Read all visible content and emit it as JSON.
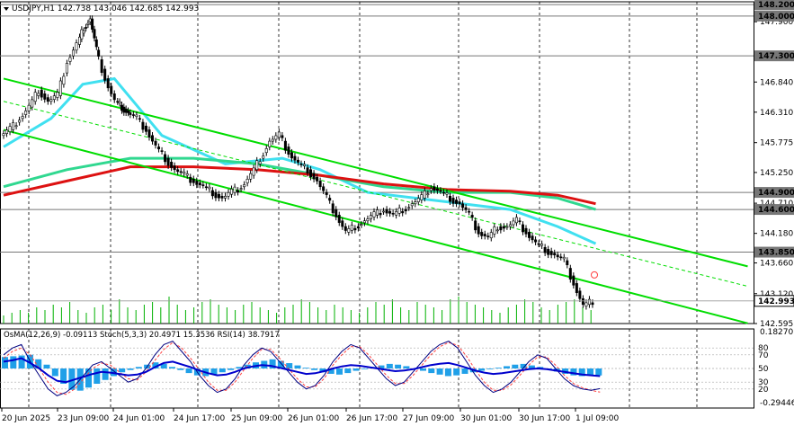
{
  "main": {
    "symbol_header": "USDJPY,H1  142.738 143.046 142.685 142.993",
    "price_ticks": [
      "148.200",
      "147.900",
      "147.300",
      "146.840",
      "146.310",
      "145.775",
      "145.250",
      "144.710",
      "144.180",
      "143.660",
      "143.120",
      "142.595"
    ],
    "levels": [
      {
        "price": "148.200",
        "role": "resistance"
      },
      {
        "price": "148.000",
        "role": "resistance"
      },
      {
        "price": "147.300",
        "role": "resistance"
      },
      {
        "price": "144.900",
        "role": "level"
      },
      {
        "price": "144.600",
        "role": "level"
      },
      {
        "price": "143.850",
        "role": "level"
      }
    ],
    "current_price": "142.993"
  },
  "indicator": {
    "header": "OsMA(12,26,9) -0.09113  Stoch(5,3,3) 20.4971 15.3536  RSI(14) 38.7917",
    "scale_right": [
      "0.182701",
      "-0.294465"
    ],
    "scale_left": [
      "80",
      "70",
      "50",
      "30",
      "20"
    ]
  },
  "time_axis": [
    "20 Jun 2025",
    "23 Jun 09:00",
    "24 Jun 01:00",
    "24 Jun 17:00",
    "25 Jun 09:00",
    "26 Jun 01:00",
    "26 Jun 17:00",
    "27 Jun 09:00",
    "30 Jun 01:00",
    "30 Jun 17:00",
    "1 Jul 09:00"
  ],
  "colors": {
    "channel": "#00dd00",
    "ema_short": "#40e0f0",
    "ema_mid": "#30d890",
    "ema_long": "#dd1111",
    "level_line": "#777777",
    "osma": "#20a0e8",
    "stoch_main": "#000080",
    "stoch_signal": "#ff4040",
    "rsi": "#0000cc",
    "volume": "#00b000"
  },
  "chart_data": {
    "type": "candlestick",
    "title": "USDJPY,H1",
    "ylim": [
      142.595,
      148.25
    ],
    "ohlc_header": {
      "open": 142.738,
      "high": 143.046,
      "low": 142.685,
      "close": 142.993
    },
    "candles_close_path": [
      [
        0,
        145.9
      ],
      [
        3,
        146.0
      ],
      [
        6,
        146.2
      ],
      [
        9,
        146.4
      ],
      [
        12,
        146.7
      ],
      [
        15,
        146.5
      ],
      [
        18,
        146.6
      ],
      [
        21,
        147.2
      ],
      [
        24,
        147.5
      ],
      [
        26,
        147.8
      ],
      [
        28,
        147.95
      ],
      [
        30,
        147.4
      ],
      [
        33,
        146.9
      ],
      [
        36,
        146.5
      ],
      [
        38,
        146.4
      ],
      [
        40,
        146.3
      ],
      [
        43,
        146.2
      ],
      [
        46,
        146.0
      ],
      [
        49,
        145.7
      ],
      [
        52,
        145.5
      ],
      [
        55,
        145.3
      ],
      [
        58,
        145.2
      ],
      [
        61,
        145.1
      ],
      [
        64,
        145.0
      ],
      [
        67,
        144.9
      ],
      [
        70,
        144.8
      ],
      [
        73,
        144.9
      ],
      [
        76,
        145.0
      ],
      [
        79,
        145.2
      ],
      [
        82,
        145.5
      ],
      [
        85,
        145.8
      ],
      [
        88,
        145.9
      ],
      [
        91,
        145.6
      ],
      [
        94,
        145.4
      ],
      [
        97,
        145.3
      ],
      [
        100,
        145.1
      ],
      [
        103,
        144.8
      ],
      [
        106,
        144.5
      ],
      [
        109,
        144.2
      ],
      [
        112,
        144.3
      ],
      [
        115,
        144.4
      ],
      [
        118,
        144.5
      ],
      [
        121,
        144.6
      ],
      [
        124,
        144.5
      ],
      [
        127,
        144.6
      ],
      [
        130,
        144.7
      ],
      [
        133,
        144.8
      ],
      [
        136,
        145.0
      ],
      [
        139,
        144.9
      ],
      [
        142,
        144.8
      ],
      [
        145,
        144.7
      ],
      [
        148,
        144.5
      ],
      [
        151,
        144.2
      ],
      [
        154,
        144.1
      ],
      [
        157,
        144.3
      ],
      [
        160,
        144.3
      ],
      [
        163,
        144.4
      ],
      [
        166,
        144.2
      ],
      [
        169,
        144.0
      ],
      [
        172,
        143.9
      ],
      [
        175,
        143.8
      ],
      [
        178,
        143.7
      ],
      [
        181,
        143.3
      ],
      [
        184,
        142.9
      ],
      [
        187,
        142.99
      ]
    ],
    "series": [
      {
        "name": "EMA short",
        "kind": "line",
        "values": [
          [
            0,
            145.7
          ],
          [
            15,
            146.2
          ],
          [
            25,
            146.8
          ],
          [
            35,
            146.9
          ],
          [
            50,
            145.9
          ],
          [
            70,
            145.4
          ],
          [
            88,
            145.5
          ],
          [
            100,
            145.3
          ],
          [
            115,
            144.9
          ],
          [
            130,
            144.8
          ],
          [
            145,
            144.7
          ],
          [
            160,
            144.6
          ],
          [
            175,
            144.3
          ],
          [
            187,
            144.0
          ]
        ]
      },
      {
        "name": "EMA mid",
        "kind": "line",
        "values": [
          [
            0,
            145.0
          ],
          [
            20,
            145.3
          ],
          [
            40,
            145.5
          ],
          [
            60,
            145.5
          ],
          [
            80,
            145.4
          ],
          [
            100,
            145.2
          ],
          [
            120,
            145.0
          ],
          [
            140,
            144.9
          ],
          [
            160,
            144.9
          ],
          [
            175,
            144.8
          ],
          [
            187,
            144.6
          ]
        ]
      },
      {
        "name": "EMA long",
        "kind": "line",
        "values": [
          [
            0,
            144.85
          ],
          [
            20,
            145.1
          ],
          [
            40,
            145.35
          ],
          [
            60,
            145.35
          ],
          [
            80,
            145.3
          ],
          [
            100,
            145.2
          ],
          [
            120,
            145.05
          ],
          [
            140,
            144.95
          ],
          [
            160,
            144.92
          ],
          [
            175,
            144.85
          ],
          [
            187,
            144.7
          ]
        ]
      }
    ],
    "channel": {
      "upper": [
        [
          0,
          146.9
        ],
        [
          235,
          143.6
        ]
      ],
      "middle": [
        [
          0,
          146.5
        ],
        [
          235,
          143.25
        ]
      ],
      "lower": [
        [
          0,
          146.0
        ],
        [
          235,
          142.6
        ]
      ]
    },
    "volumes": [
      3,
      4,
      5,
      4,
      6,
      5,
      7,
      6,
      8,
      5,
      4,
      6,
      7,
      5,
      9,
      6,
      5,
      7,
      8,
      6,
      10,
      7,
      5,
      6,
      8,
      9,
      7,
      6,
      5,
      7,
      8,
      6,
      5,
      4,
      6,
      7,
      9,
      8,
      6,
      5,
      7,
      6,
      5,
      4,
      6,
      8,
      7,
      9,
      6,
      5,
      8,
      7,
      6,
      5,
      9,
      10,
      8,
      7,
      6,
      5,
      4,
      6,
      7,
      9,
      8,
      6,
      5,
      7,
      8,
      9,
      6,
      5
    ],
    "osma": [
      0.15,
      0.16,
      0.17,
      0.18,
      0.12,
      0.05,
      -0.1,
      -0.2,
      -0.28,
      -0.29,
      -0.25,
      -0.2,
      -0.15,
      -0.1,
      -0.05,
      -0.02,
      0.02,
      0.05,
      0.08,
      0.06,
      0.02,
      -0.02,
      -0.06,
      -0.09,
      -0.1,
      -0.08,
      -0.05,
      -0.02,
      0.02,
      0.05,
      0.08,
      0.1,
      0.12,
      0.1,
      0.07,
      0.04,
      0.01,
      -0.02,
      -0.05,
      -0.07,
      -0.08,
      -0.06,
      -0.03,
      0.0,
      0.02,
      0.04,
      0.06,
      0.05,
      0.03,
      0.0,
      -0.03,
      -0.06,
      -0.08,
      -0.1,
      -0.09,
      -0.07,
      -0.05,
      -0.03,
      -0.01,
      0.01,
      0.03,
      0.05,
      0.06,
      0.04,
      0.02,
      -0.01,
      -0.04,
      -0.07,
      -0.09,
      -0.1,
      -0.09,
      -0.09113
    ],
    "stoch_main": [
      70,
      80,
      85,
      60,
      40,
      20,
      10,
      15,
      25,
      40,
      55,
      60,
      50,
      40,
      30,
      35,
      50,
      70,
      85,
      90,
      75,
      60,
      40,
      25,
      15,
      20,
      35,
      55,
      70,
      80,
      75,
      60,
      45,
      30,
      20,
      25,
      40,
      60,
      75,
      85,
      80,
      65,
      50,
      35,
      25,
      30,
      45,
      60,
      75,
      85,
      90,
      80,
      60,
      40,
      25,
      15,
      20,
      30,
      45,
      60,
      70,
      65,
      50,
      35,
      25,
      20,
      18,
      20.4971
    ],
    "stoch_signal": [
      65,
      75,
      80,
      70,
      50,
      30,
      15,
      12,
      20,
      35,
      50,
      58,
      55,
      45,
      35,
      33,
      45,
      62,
      78,
      88,
      80,
      65,
      48,
      30,
      18,
      18,
      30,
      48,
      65,
      78,
      78,
      65,
      50,
      35,
      23,
      23,
      35,
      55,
      70,
      82,
      82,
      70,
      55,
      40,
      28,
      28,
      40,
      55,
      70,
      82,
      88,
      84,
      68,
      48,
      30,
      18,
      18,
      26,
      40,
      55,
      67,
      67,
      55,
      40,
      28,
      22,
      18,
      15.3536
    ],
    "rsi": [
      60,
      62,
      65,
      58,
      50,
      40,
      32,
      30,
      34,
      38,
      42,
      45,
      44,
      42,
      40,
      41,
      45,
      52,
      58,
      60,
      56,
      52,
      47,
      43,
      40,
      41,
      45,
      50,
      53,
      55,
      54,
      51,
      48,
      45,
      42,
      43,
      46,
      50,
      53,
      55,
      54,
      52,
      50,
      48,
      46,
      47,
      49,
      52,
      55,
      57,
      58,
      55,
      51,
      47,
      44,
      42,
      43,
      45,
      47,
      49,
      50,
      49,
      47,
      45,
      43,
      41,
      40,
      38.7917
    ]
  }
}
